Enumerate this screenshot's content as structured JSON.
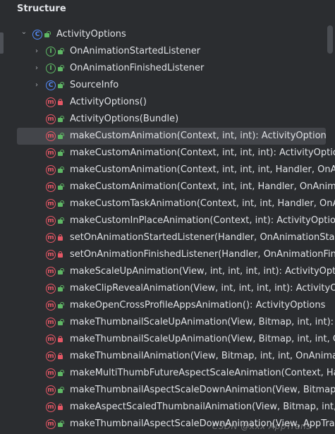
{
  "panel": {
    "title": "Structure",
    "watermark": "CSDN @xxx AppTrans"
  },
  "tree": {
    "root": {
      "label": "ActivityOptions",
      "kind": "class",
      "access": "public",
      "expanded": true
    },
    "children": [
      {
        "label": "OnAnimationStartedListener",
        "kind": "iface",
        "access": "public",
        "expandable": true
      },
      {
        "label": "OnAnimationFinishedListener",
        "kind": "iface",
        "access": "public",
        "expandable": true
      },
      {
        "label": "SourceInfo",
        "kind": "class",
        "access": "public",
        "expandable": true
      },
      {
        "label": "ActivityOptions()",
        "kind": "method",
        "access": "private"
      },
      {
        "label": "ActivityOptions(Bundle)",
        "kind": "method",
        "access": "public"
      },
      {
        "label": "makeCustomAnimation(Context, int, int): ActivityOptions",
        "kind": "method",
        "access": "public",
        "selected": true
      },
      {
        "label": "makeCustomAnimation(Context, int, int, int): ActivityOptions",
        "kind": "method",
        "access": "public"
      },
      {
        "label": "makeCustomAnimation(Context, int, int, int, Handler, OnAnimationStartedListener)",
        "kind": "method",
        "access": "public"
      },
      {
        "label": "makeCustomAnimation(Context, int, int, Handler, OnAnimationStartedListener)",
        "kind": "method",
        "access": "public"
      },
      {
        "label": "makeCustomTaskAnimation(Context, int, int, Handler, OnAnimationStartedListener)",
        "kind": "method",
        "access": "public"
      },
      {
        "label": "makeCustomInPlaceAnimation(Context, int): ActivityOptions",
        "kind": "method",
        "access": "public"
      },
      {
        "label": "setOnAnimationStartedListener(Handler, OnAnimationStartedListener)",
        "kind": "method",
        "access": "private"
      },
      {
        "label": "setOnAnimationFinishedListener(Handler, OnAnimationFinishedListener)",
        "kind": "method",
        "access": "private"
      },
      {
        "label": "makeScaleUpAnimation(View, int, int, int, int): ActivityOptions",
        "kind": "method",
        "access": "public"
      },
      {
        "label": "makeClipRevealAnimation(View, int, int, int, int): ActivityOptions",
        "kind": "method",
        "access": "public"
      },
      {
        "label": "makeOpenCrossProfileAppsAnimation(): ActivityOptions",
        "kind": "method",
        "access": "public"
      },
      {
        "label": "makeThumbnailScaleUpAnimation(View, Bitmap, int, int): ActivityOptions",
        "kind": "method",
        "access": "public"
      },
      {
        "label": "makeThumbnailScaleUpAnimation(View, Bitmap, int, int, OnAnimationStartedListener)",
        "kind": "method",
        "access": "private"
      },
      {
        "label": "makeThumbnailAnimation(View, Bitmap, int, int, OnAnimationStartedListener)",
        "kind": "method",
        "access": "private"
      },
      {
        "label": "makeMultiThumbFutureAspectScaleAnimation(Context, Handler)",
        "kind": "method",
        "access": "public"
      },
      {
        "label": "makeThumbnailAspectScaleDownAnimation(View, Bitmap, int, int)",
        "kind": "method",
        "access": "public"
      },
      {
        "label": "makeAspectScaledThumbnailAnimation(View, Bitmap, int, int)",
        "kind": "method",
        "access": "private"
      },
      {
        "label": "makeThumbnailAspectScaleDownAnimation(View, AppTransitionAnimationSpec)",
        "kind": "method",
        "access": "public"
      }
    ]
  },
  "icons": {
    "class_letter": "C",
    "iface_letter": "I",
    "method_letter": "m",
    "chevron_expanded": "⌄",
    "chevron_collapsed": "›"
  }
}
